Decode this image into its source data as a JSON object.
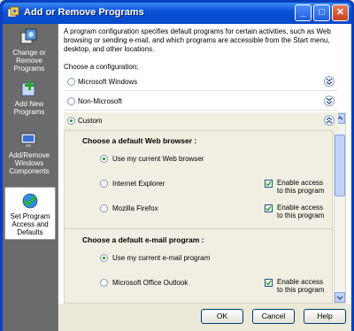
{
  "window": {
    "title": "Add or Remove Programs",
    "buttons": {
      "minimize": "_",
      "maximize": "□",
      "close": "✕"
    }
  },
  "sidebar": {
    "items": [
      {
        "label": "Change or Remove Programs",
        "icon": "change-remove-programs-icon",
        "active": false
      },
      {
        "label": "Add New Programs",
        "icon": "add-new-programs-icon",
        "active": false
      },
      {
        "label": "Add/Remove Windows Components",
        "icon": "windows-components-icon",
        "active": false
      },
      {
        "label": "Set Program Access and Defaults",
        "icon": "set-program-access-icon",
        "active": true
      }
    ]
  },
  "main": {
    "intro": "A program configuration specifies default programs for certain activities, such as Web browsing or sending e-mail, and which programs are accessible from the Start menu, desktop, and other locations.",
    "choose_label": "Choose a configuration:",
    "configurations": [
      {
        "label": "Microsoft Windows",
        "selected": false,
        "expanded": false
      },
      {
        "label": "Non-Microsoft",
        "selected": false,
        "expanded": false
      },
      {
        "label": "Custom",
        "selected": true,
        "expanded": true
      }
    ],
    "custom": {
      "browser_title": "Choose a default Web browser :",
      "browser_options": [
        {
          "label": "Use my current Web browser",
          "selected": true,
          "enable_access": null
        },
        {
          "label": "Internet Explorer",
          "selected": false,
          "enable_access": "Enable access to this program",
          "checked": true
        },
        {
          "label": "Mozilla Firefox",
          "selected": false,
          "enable_access": "Enable access to this program",
          "checked": true
        }
      ],
      "email_title": "Choose a default e-mail program :",
      "email_options": [
        {
          "label": "Use my current e-mail program",
          "selected": true,
          "enable_access": null
        },
        {
          "label": "Microsoft Office Outlook",
          "selected": false,
          "enable_access": "Enable access to this program",
          "checked": true
        }
      ]
    }
  },
  "buttons": {
    "ok": "OK",
    "cancel": "Cancel",
    "help": "Help"
  },
  "colors": {
    "title_bar": "#0a52d8",
    "sidebar": "#6b6b6b",
    "panel": "#f1efe2",
    "radio_dot": "#1f8f1f"
  }
}
